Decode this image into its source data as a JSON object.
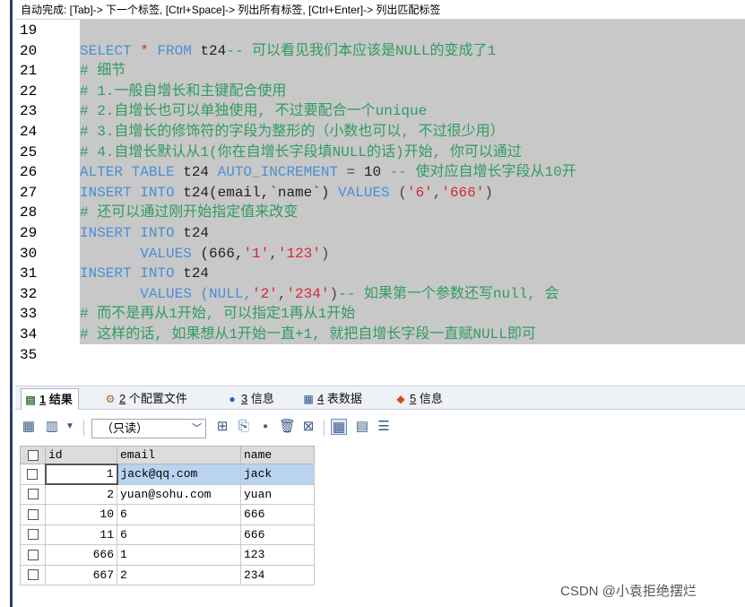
{
  "hint_bar": "自动完成: [Tab]-> 下一个标签, [Ctrl+Space]-> 列出所有标签, [Ctrl+Enter]-> 列出匹配标签",
  "editor": {
    "line_numbers": [
      "19",
      "20",
      "21",
      "22",
      "23",
      "24",
      "25",
      "26",
      "27",
      "28",
      "29",
      "30",
      "31",
      "32",
      "33",
      "34",
      "35"
    ],
    "lines": [
      [],
      [
        {
          "t": "SELECT ",
          "c": "kw"
        },
        {
          "t": "* ",
          "c": "st"
        },
        {
          "t": "FROM ",
          "c": "kw"
        },
        {
          "t": "t24",
          "c": "id"
        },
        {
          "t": "-- 可以看见我们本应该是NULL的变成了1",
          "c": "cm"
        }
      ],
      [
        {
          "t": "# 细节",
          "c": "cm"
        }
      ],
      [
        {
          "t": "# 1.一般自增长和主键配合使用",
          "c": "cm"
        }
      ],
      [
        {
          "t": "# 2.自增长也可以单独使用, 不过要配合一个unique",
          "c": "cm"
        }
      ],
      [
        {
          "t": "# 3.自增长的修饰符的字段为整形的（小数也可以, 不过很少用）",
          "c": "cm"
        }
      ],
      [
        {
          "t": "# 4.自增长默认从1(你在自增长字段填NULL的话)开始, 你可以通过",
          "c": "cm"
        }
      ],
      [
        {
          "t": "ALTER TABLE ",
          "c": "kw"
        },
        {
          "t": "t24 ",
          "c": "id"
        },
        {
          "t": "AUTO_INCREMENT ",
          "c": "kw"
        },
        {
          "t": "= ",
          "c": "op"
        },
        {
          "t": "10 ",
          "c": "id"
        },
        {
          "t": "-- 使对应自增长字段从10开",
          "c": "cm"
        }
      ],
      [
        {
          "t": "INSERT INTO ",
          "c": "kw"
        },
        {
          "t": "t24(email,`name`) ",
          "c": "id"
        },
        {
          "t": "VALUES ",
          "c": "kw"
        },
        {
          "t": "(",
          "c": "op"
        },
        {
          "t": "'6'",
          "c": "st"
        },
        {
          "t": ",",
          "c": "op"
        },
        {
          "t": "'666'",
          "c": "st"
        },
        {
          "t": ")",
          "c": "op"
        }
      ],
      [
        {
          "t": "# 还可以通过刚开始指定值来改变",
          "c": "cm"
        }
      ],
      [
        {
          "t": "INSERT INTO ",
          "c": "kw"
        },
        {
          "t": "t24",
          "c": "id"
        }
      ],
      [
        {
          "t": "       VALUES ",
          "c": "kw"
        },
        {
          "t": "(666,",
          "c": "id"
        },
        {
          "t": "'1'",
          "c": "st"
        },
        {
          "t": ",",
          "c": "op"
        },
        {
          "t": "'123'",
          "c": "st"
        },
        {
          "t": ")",
          "c": "op"
        }
      ],
      [
        {
          "t": "INSERT INTO ",
          "c": "kw"
        },
        {
          "t": "t24",
          "c": "id"
        }
      ],
      [
        {
          "t": "       VALUES ",
          "c": "kw"
        },
        {
          "t": "(NULL,",
          "c": "kw"
        },
        {
          "t": "'2'",
          "c": "st"
        },
        {
          "t": ",",
          "c": "op"
        },
        {
          "t": "'234'",
          "c": "st"
        },
        {
          "t": ")",
          "c": "op"
        },
        {
          "t": "-- 如果第一个参数还写null, 会",
          "c": "cm"
        }
      ],
      [
        {
          "t": "# 而不是再从1开始, 可以指定1再从1开始",
          "c": "cm"
        }
      ],
      [
        {
          "t": "# 这样的话, 如果想从1开始一直+1, 就把自增长字段一直赋NULL即可",
          "c": "cm"
        }
      ],
      []
    ]
  },
  "tabs": [
    {
      "num": "1",
      "label": "结果",
      "icon": "result-table-icon"
    },
    {
      "num": "2",
      "label": "个配置文件",
      "icon": "profile-icon"
    },
    {
      "num": "3",
      "label": "信息",
      "icon": "info-icon"
    },
    {
      "num": "4",
      "label": "表数据",
      "icon": "table-data-icon"
    },
    {
      "num": "5",
      "label": "信息",
      "icon": "info-colored-icon"
    }
  ],
  "toolbar": {
    "readonly_label": "（只读）"
  },
  "results": {
    "columns": [
      "id",
      "email",
      "name"
    ],
    "rows": [
      {
        "id": "1",
        "email": "jack@qq.com",
        "name": "jack"
      },
      {
        "id": "2",
        "email": "yuan@sohu.com",
        "name": "yuan"
      },
      {
        "id": "10",
        "email": "6",
        "name": "666"
      },
      {
        "id": "11",
        "email": "6",
        "name": "666"
      },
      {
        "id": "666",
        "email": "1",
        "name": "123"
      },
      {
        "id": "667",
        "email": "2",
        "name": "234"
      }
    ]
  },
  "watermark": "CSDN @小袁拒绝摆烂"
}
